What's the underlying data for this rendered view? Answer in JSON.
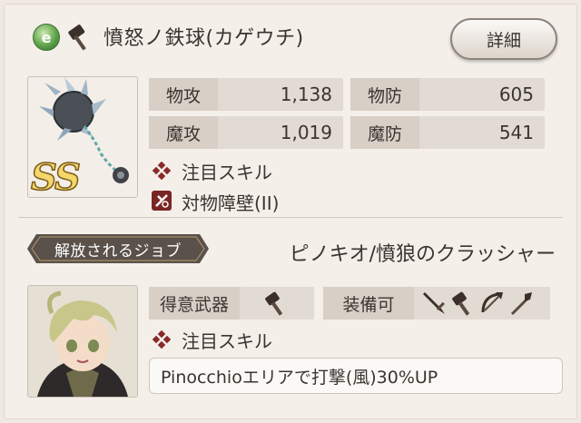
{
  "weapon": {
    "name": "憤怒ノ鉄球(カゲウチ)",
    "category_icon": "element-icon",
    "type_icon": "hammer-icon",
    "rank": "SS"
  },
  "detail_button": "詳細",
  "stats": [
    {
      "label": "物攻",
      "value": "1,138"
    },
    {
      "label": "物防",
      "value": "605"
    },
    {
      "label": "魔攻",
      "value": "1,019"
    },
    {
      "label": "魔防",
      "value": "541"
    }
  ],
  "skills": [
    {
      "icon": "cross-skill-icon",
      "label": "注目スキル"
    },
    {
      "icon": "barrier-skill-icon",
      "label": "対物障壁(II)"
    }
  ],
  "job": {
    "ribbon_label": "解放されるジョブ",
    "name": "ピノキオ/憤狼のクラッシャー",
    "favorite_weapon_label": "得意武器",
    "equippable_label": "装備可",
    "skill_label": "注目スキル",
    "skill_desc": "Pinocchioエリアで打撃(風)30%UP"
  },
  "colors": {
    "accent_red": "#7a2524",
    "panel_bg": "#f4efe9",
    "stat_label_bg": "#d8cfc6",
    "rank_gold": "#f3d76a"
  }
}
